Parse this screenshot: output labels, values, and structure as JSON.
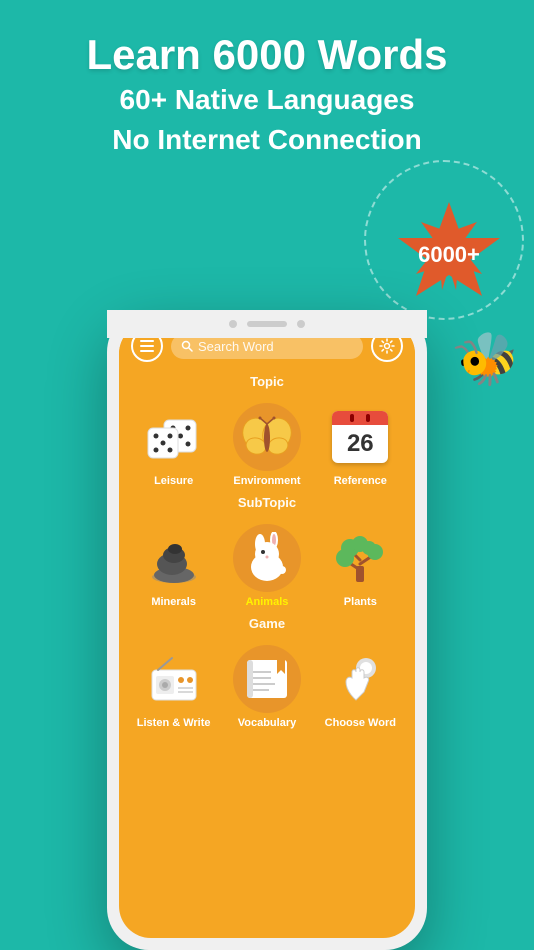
{
  "background_color": "#1ab8a8",
  "hero": {
    "title": "Learn  6000 Words",
    "sub1": "60+ Native Languages",
    "sub2": "No Internet Connection"
  },
  "badge": {
    "text": "6000+",
    "color": "#e05a2b"
  },
  "bee_emoji": "🐝",
  "app": {
    "search_placeholder": "Search Word",
    "sections": {
      "topic_label": "Topic",
      "subtopic_label": "SubTopic",
      "game_label": "Game"
    },
    "topic_items": [
      {
        "label": "Leisure"
      },
      {
        "label": "Environment"
      },
      {
        "label": "26 Reference"
      }
    ],
    "subtopic_items": [
      {
        "label": "Minerals"
      },
      {
        "label": "Animals",
        "highlight": true
      },
      {
        "label": "Plants"
      }
    ],
    "game_items": [
      {
        "label": "Listen & Write"
      },
      {
        "label": "Vocabulary"
      },
      {
        "label": "Choose Word"
      }
    ]
  }
}
